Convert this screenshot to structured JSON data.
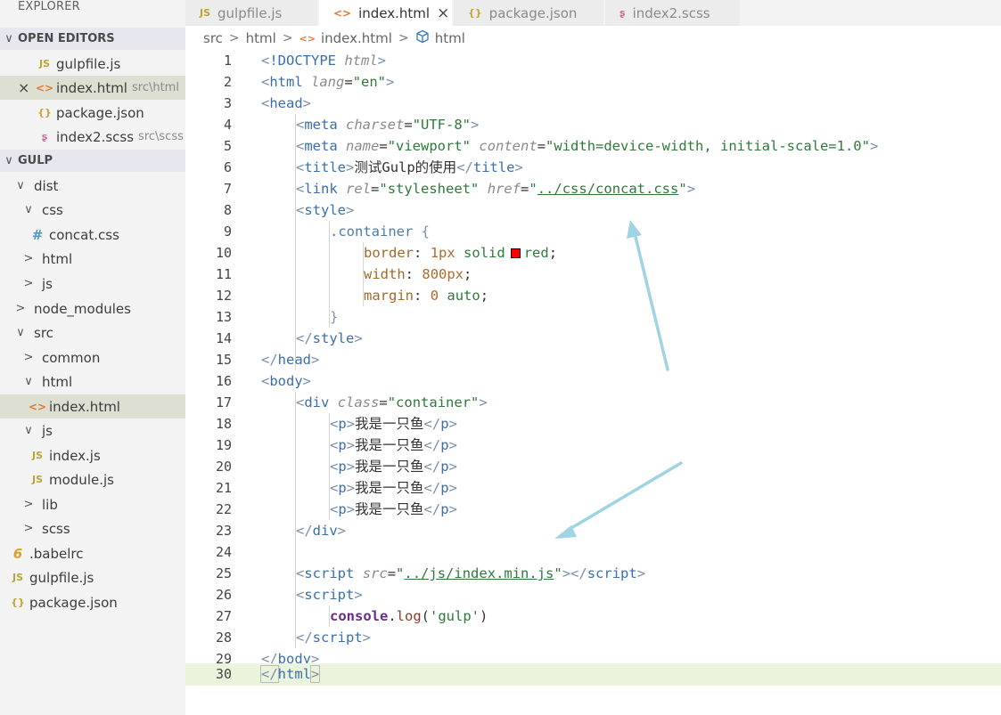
{
  "sidebar": {
    "title": "EXPLORER",
    "open_editors": {
      "label": "OPEN EDITORS",
      "items": [
        {
          "icon": "JS",
          "name": "gulpfile.js",
          "desc": ""
        },
        {
          "icon": "<>",
          "name": "index.html",
          "desc": "src\\html",
          "close": "×"
        },
        {
          "icon": "{}",
          "name": "package.json",
          "desc": ""
        },
        {
          "icon": "ʂ",
          "name": "index2.scss",
          "desc": "src\\scss"
        }
      ]
    },
    "project": {
      "label": "GULP",
      "items": [
        {
          "chev": "∨",
          "name": "dist"
        },
        {
          "chev": "∨",
          "name": "css"
        },
        {
          "icon": "#",
          "name": "concat.css"
        },
        {
          "chev": ">",
          "name": "html"
        },
        {
          "chev": ">",
          "name": "js"
        },
        {
          "chev": ">",
          "name": "node_modules"
        },
        {
          "chev": "∨",
          "name": "src"
        },
        {
          "chev": ">",
          "name": "common"
        },
        {
          "chev": "∨",
          "name": "html"
        },
        {
          "icon": "<>",
          "name": "index.html"
        },
        {
          "chev": "∨",
          "name": "js"
        },
        {
          "icon": "JS",
          "name": "index.js"
        },
        {
          "icon": "JS",
          "name": "module.js"
        },
        {
          "chev": ">",
          "name": "lib"
        },
        {
          "chev": ">",
          "name": "scss"
        },
        {
          "icon": "6",
          "name": ".babelrc"
        },
        {
          "icon": "JS",
          "name": "gulpfile.js"
        },
        {
          "icon": "{}",
          "name": "package.json"
        }
      ]
    }
  },
  "tabs": [
    {
      "icon": "JS",
      "label": "gulpfile.js"
    },
    {
      "icon": "<>",
      "label": "index.html",
      "close": "×"
    },
    {
      "icon": "{}",
      "label": "package.json"
    },
    {
      "icon": "ʂ",
      "label": "index2.scss"
    }
  ],
  "breadcrumb": {
    "seg1": "src",
    "seg2": "html",
    "seg3": "index.html",
    "seg4": "html",
    "sep": ">"
  },
  "editor": {
    "line_numbers": [
      "1",
      "2",
      "3",
      "4",
      "5",
      "6",
      "7",
      "8",
      "9",
      "10",
      "11",
      "12",
      "13",
      "14",
      "15",
      "16",
      "17",
      "18",
      "19",
      "20",
      "21",
      "22",
      "23",
      "24",
      "25",
      "26",
      "27",
      "28",
      "29",
      "30"
    ],
    "tok": {
      "lt": "<",
      "gt": ">",
      "lts": "</",
      "eq": "=",
      "sp": " ",
      "semi": ";",
      "q": "\"",
      "doctype": "!DOCTYPE",
      "html": "html",
      "lang": "lang",
      "en": "\"en\"",
      "head": "head",
      "meta": "meta",
      "charset": "charset",
      "utf8": "\"UTF-8\"",
      "name": "name",
      "viewport": "\"viewport\"",
      "content": "content",
      "content_val": "\"width=device-width, initial-scale=1.0\"",
      "title": "title",
      "title_text": "测试Gulp的使用",
      "link": "link",
      "rel": "rel",
      "stylesheet": "\"stylesheet\"",
      "href": "href",
      "href_val": "../css/concat.css",
      "style": "style",
      "selector": ".container",
      "lbrace": "{",
      "rbrace": "}",
      "border": "border",
      "colon": ":",
      "border_px": "1px",
      "solid": "solid",
      "red": "red",
      "width": "width",
      "width_val": "800px",
      "margin": "margin",
      "zero": "0",
      "auto": "auto",
      "body": "body",
      "div": "div",
      "class": "class",
      "container_val": "\"container\"",
      "p": "p",
      "p_text": "我是一只鱼",
      "script": "script",
      "src": "src",
      "src_val": "../js/index.min.js",
      "console": "console",
      "dot": ".",
      "log": "log",
      "lparen": "(",
      "rparen": ")",
      "gulp_str": "'gulp'"
    }
  },
  "colors": {
    "annotation_arrow": "#9fd4e4",
    "current_line": "#eaf4dd",
    "active_row": "#dcdfd2"
  }
}
